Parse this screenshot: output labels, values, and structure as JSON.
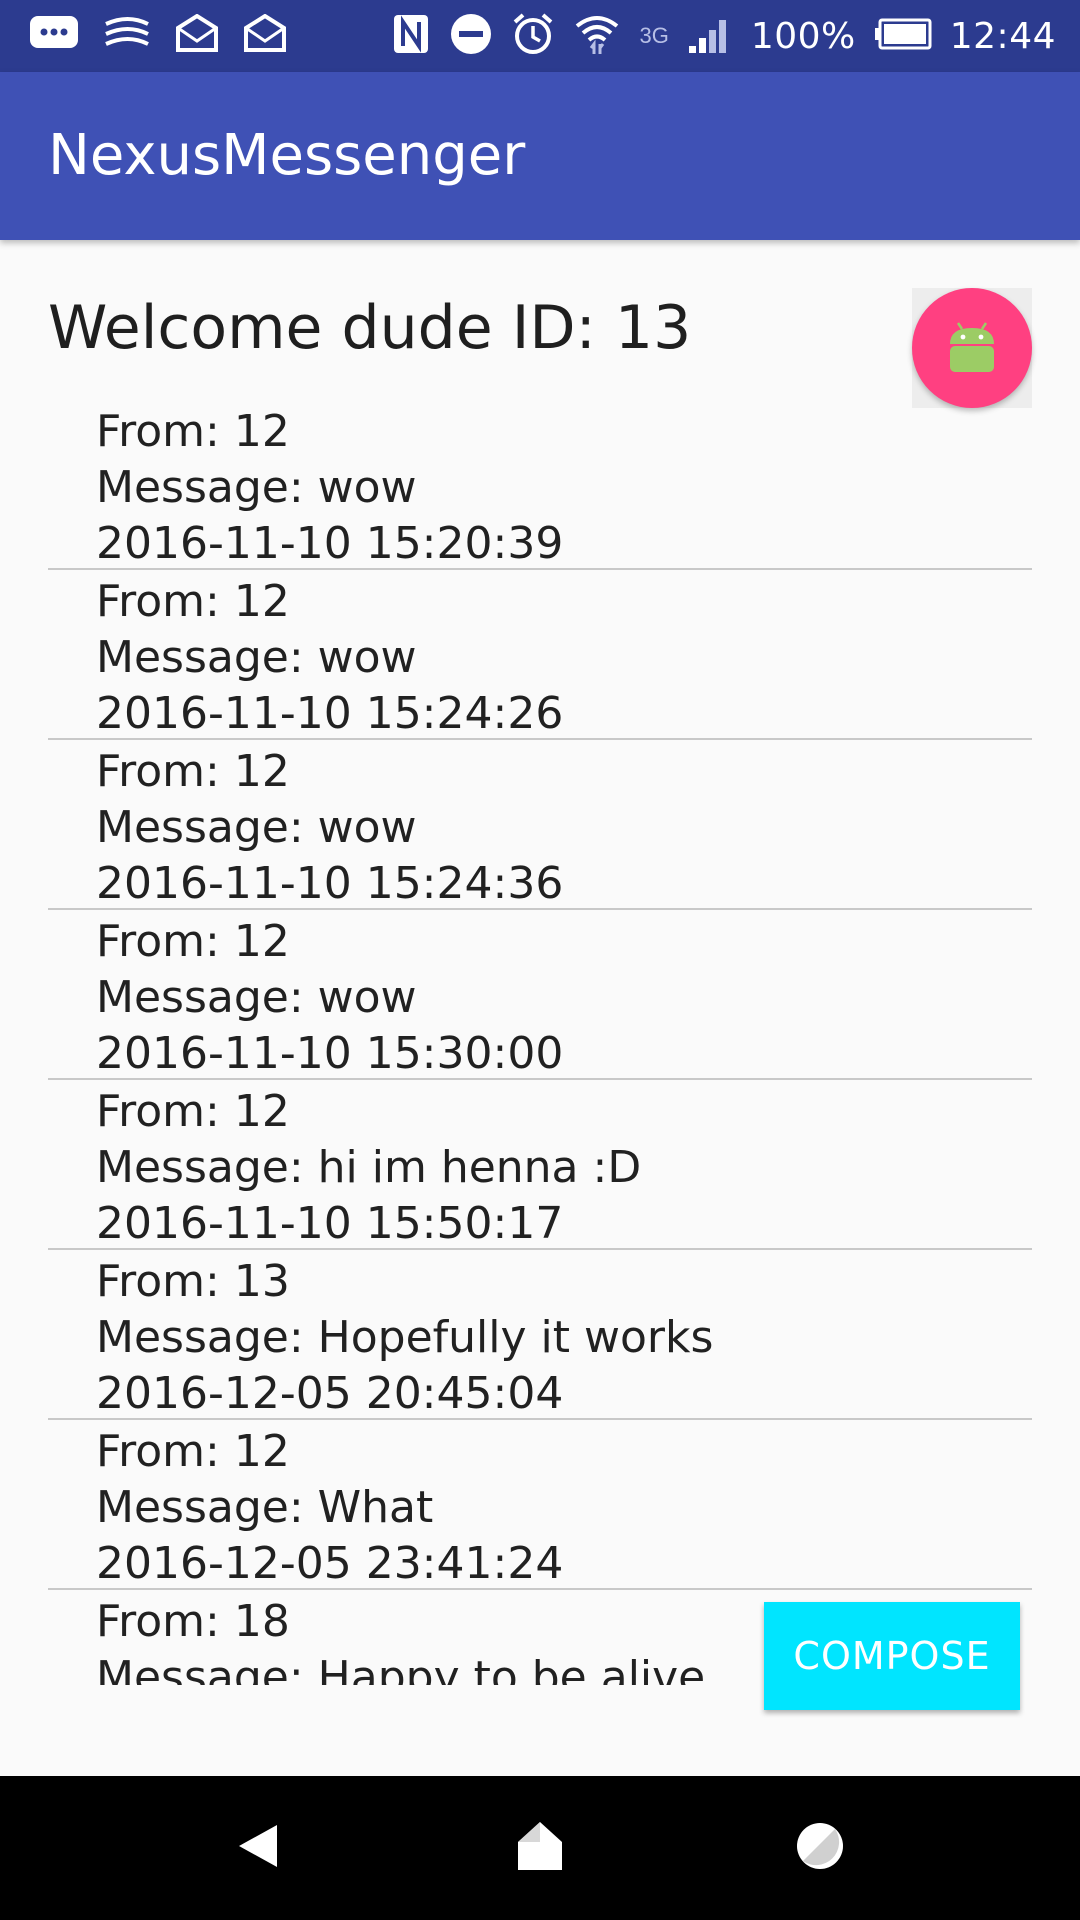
{
  "status_bar": {
    "icons_left": [
      "chat-bubble-icon",
      "swiftkey-icon",
      "mail-icon",
      "mail-icon"
    ],
    "icons_right": [
      "nfc-icon",
      "do-not-disturb-icon",
      "alarm-icon",
      "wifi-icon",
      "signal-icon",
      "battery-icon"
    ],
    "network": "3G",
    "battery": "100%",
    "time": "12:44"
  },
  "app_bar": {
    "title": "NexusMessenger",
    "color": "#3f51b5"
  },
  "welcome": "Welcome dude ID: 13",
  "fab": {
    "icon": "android-icon",
    "color": "#ff4081"
  },
  "messages": [
    {
      "from": "From: 12",
      "message": "Message: wow",
      "time": "2016-11-10 15:20:39"
    },
    {
      "from": "From: 12",
      "message": "Message: wow",
      "time": "2016-11-10 15:24:26"
    },
    {
      "from": "From: 12",
      "message": "Message: wow",
      "time": "2016-11-10 15:24:36"
    },
    {
      "from": "From: 12",
      "message": "Message: wow",
      "time": "2016-11-10 15:30:00"
    },
    {
      "from": "From: 12",
      "message": "Message: hi im henna :D",
      "time": "2016-11-10 15:50:17"
    },
    {
      "from": "From: 13",
      "message": "Message: Hopefully it works",
      "time": "2016-12-05 20:45:04"
    },
    {
      "from": "From: 12",
      "message": "Message: What",
      "time": "2016-12-05 23:41:24"
    },
    {
      "from": "From: 18",
      "message": "Message: Happy to be alive",
      "time": ""
    }
  ],
  "compose_button": {
    "label": "COMPOSE",
    "color": "#00e5ff"
  },
  "nav_bar": {
    "icons": [
      "back-icon",
      "home-icon",
      "recents-icon"
    ]
  }
}
